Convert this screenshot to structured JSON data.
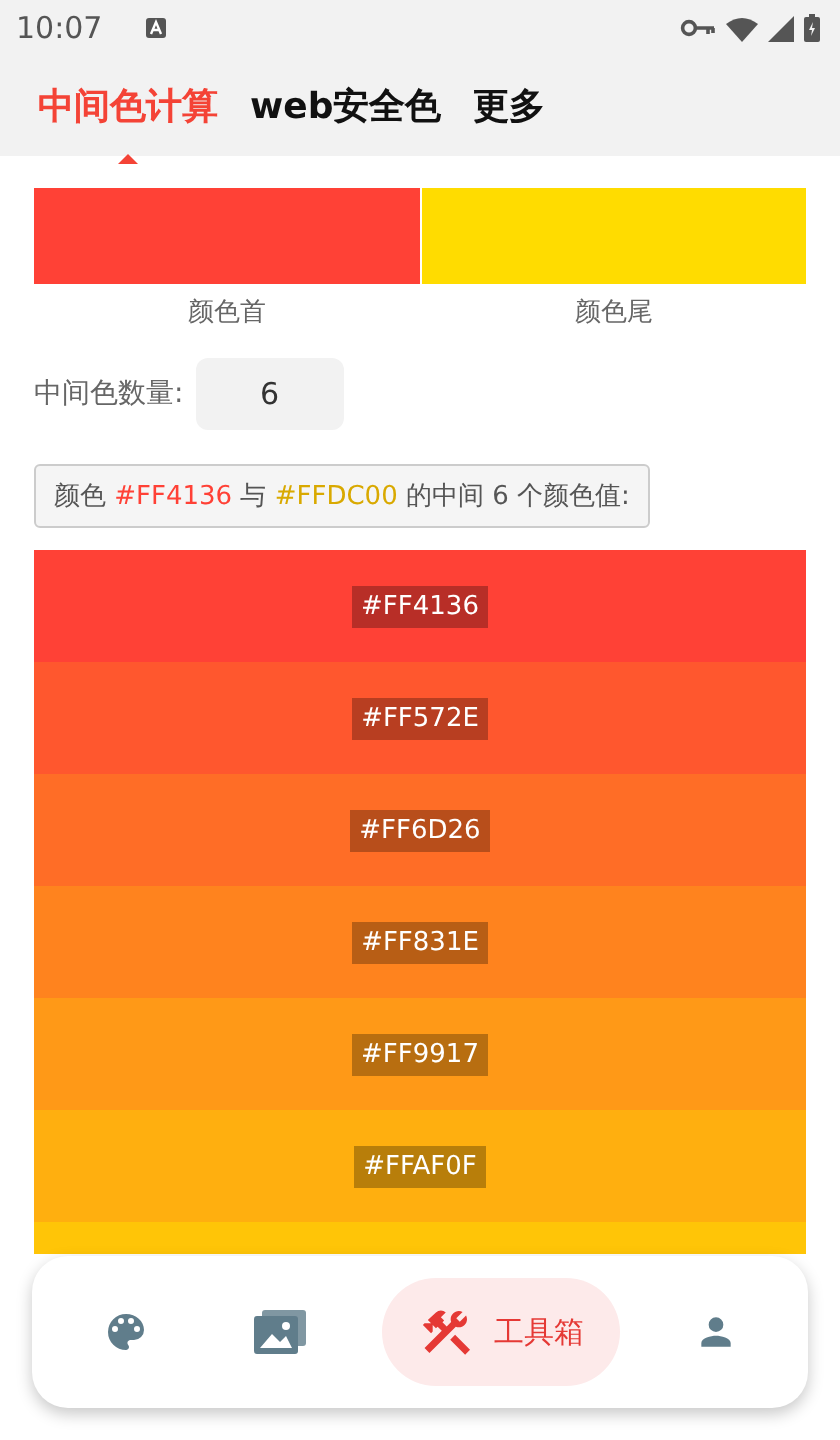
{
  "status_bar": {
    "time": "10:07"
  },
  "tabs": [
    {
      "label": "中间色计算",
      "selected": true
    },
    {
      "label": "web安全色",
      "selected": false
    },
    {
      "label": "更多",
      "selected": false
    }
  ],
  "swatches": [
    {
      "label": "颜色首",
      "color": "#ff4136"
    },
    {
      "label": "颜色尾",
      "color": "#ffdc00"
    }
  ],
  "count": {
    "label": "中间色数量:",
    "value": "6"
  },
  "summary": [
    {
      "text": "颜色"
    },
    {
      "text": "#FF4136",
      "color": "#ff4136"
    },
    {
      "text": "与"
    },
    {
      "text": "#FFDC00",
      "color": "#d9a900"
    },
    {
      "text": "的中间 6 个颜色值:"
    }
  ],
  "colors": [
    {
      "hex": "#FF4136",
      "color": "#ff4136"
    },
    {
      "hex": "#FF572E",
      "color": "#ff572e"
    },
    {
      "hex": "#FF6D26",
      "color": "#ff6d26"
    },
    {
      "hex": "#FF831E",
      "color": "#ff831e"
    },
    {
      "hex": "#FF9917",
      "color": "#ff9917"
    },
    {
      "hex": "#FFAF0F",
      "color": "#ffaf0f"
    },
    {
      "color": "#ffc507"
    }
  ],
  "nav": [
    {
      "kind": "palette",
      "selected": false
    },
    {
      "kind": "gallery",
      "selected": false
    },
    {
      "kind": "tools",
      "label": "工具箱",
      "selected": true
    },
    {
      "kind": "person",
      "selected": false
    }
  ]
}
